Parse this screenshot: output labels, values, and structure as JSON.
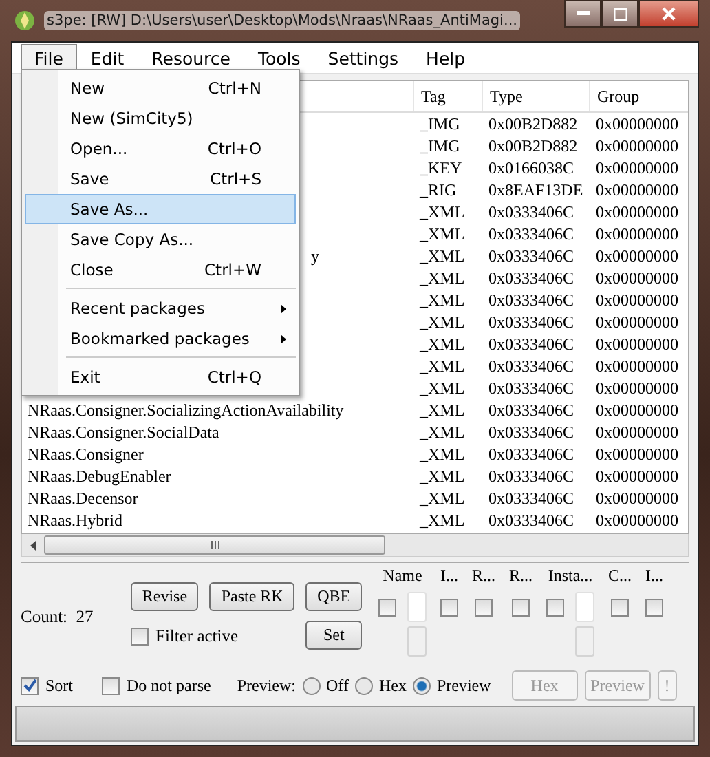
{
  "window": {
    "title": "s3pe: [RW] D:\\Users\\user\\Desktop\\Mods\\Nraas\\NRaas_AntiMagi..."
  },
  "menu_bar": [
    {
      "label": "File",
      "selected": true
    },
    {
      "label": "Edit",
      "selected": false
    },
    {
      "label": "Resource",
      "selected": false
    },
    {
      "label": "Tools",
      "selected": false
    },
    {
      "label": "Settings",
      "selected": false
    },
    {
      "label": "Help",
      "selected": false
    }
  ],
  "file_menu": [
    {
      "kind": "item",
      "label": "New",
      "shortcut": "Ctrl+N",
      "selected": false
    },
    {
      "kind": "item",
      "label": "New (SimCity5)",
      "selected": false
    },
    {
      "kind": "item",
      "label": "Open...",
      "shortcut": "Ctrl+O",
      "selected": false
    },
    {
      "kind": "item",
      "label": "Save",
      "shortcut": "Ctrl+S",
      "selected": false
    },
    {
      "kind": "item",
      "label": "Save As...",
      "selected": true
    },
    {
      "kind": "item",
      "label": "Save Copy As...",
      "selected": false
    },
    {
      "kind": "item",
      "label": "Close",
      "shortcut": "Ctrl+W",
      "selected": false
    },
    {
      "kind": "separator"
    },
    {
      "kind": "submenu",
      "label": "Recent packages",
      "selected": false
    },
    {
      "kind": "submenu",
      "label": "Bookmarked packages",
      "selected": false
    },
    {
      "kind": "separator"
    },
    {
      "kind": "item",
      "label": "Exit",
      "shortcut": "Ctrl+Q",
      "selected": false
    }
  ],
  "table": {
    "columns": [
      "Tag",
      "Type",
      "Group"
    ],
    "rows": [
      {
        "tag": "_IMG",
        "type": "0x00B2D882",
        "group": "0x00000000"
      },
      {
        "tag": "_IMG",
        "type": "0x00B2D882",
        "group": "0x00000000"
      },
      {
        "tag": "_KEY",
        "type": "0x0166038C",
        "group": "0x00000000"
      },
      {
        "tag": "_RIG",
        "type": "0x8EAF13DE",
        "group": "0x00000000"
      },
      {
        "tag": "_XML",
        "type": "0x0333406C",
        "group": "0x00000000"
      },
      {
        "tag": "_XML",
        "type": "0x0333406C",
        "group": "0x00000000"
      },
      {
        "name_tail": "y",
        "tag": "_XML",
        "type": "0x0333406C",
        "group": "0x00000000"
      },
      {
        "tag": "_XML",
        "type": "0x0333406C",
        "group": "0x00000000"
      },
      {
        "tag": "_XML",
        "type": "0x0333406C",
        "group": "0x00000000"
      },
      {
        "tag": "_XML",
        "type": "0x0333406C",
        "group": "0x00000000"
      },
      {
        "tag": "_XML",
        "type": "0x0333406C",
        "group": "0x00000000"
      },
      {
        "tag": "_XML",
        "type": "0x0333406C",
        "group": "0x00000000"
      },
      {
        "tag": "_XML",
        "type": "0x0333406C",
        "group": "0x00000000"
      },
      {
        "name": "NRaas.Consigner.SocializingActionAvailability",
        "tag": "_XML",
        "type": "0x0333406C",
        "group": "0x00000000"
      },
      {
        "name": "NRaas.Consigner.SocialData",
        "tag": "_XML",
        "type": "0x0333406C",
        "group": "0x00000000"
      },
      {
        "name": "NRaas.Consigner",
        "tag": "_XML",
        "type": "0x0333406C",
        "group": "0x00000000"
      },
      {
        "name": "NRaas.DebugEnabler",
        "tag": "_XML",
        "type": "0x0333406C",
        "group": "0x00000000"
      },
      {
        "name": "NRaas.Decensor",
        "tag": "_XML",
        "type": "0x0333406C",
        "group": "0x00000000"
      },
      {
        "name": "NRaas.Hybrid",
        "tag": "_XML",
        "type": "0x0333406C",
        "group": "0x00000000"
      }
    ]
  },
  "count": {
    "label": "Count:",
    "value": "27"
  },
  "buttons": {
    "revise": "Revise",
    "paste_rk": "Paste RK",
    "qbe": "QBE",
    "set": "Set"
  },
  "filter_active": {
    "label": "Filter active",
    "checked": false
  },
  "filter_columns": [
    {
      "label": "Name",
      "kind": "text",
      "checked": false
    },
    {
      "label": "I...",
      "kind": "check",
      "checked": false
    },
    {
      "label": "R...",
      "kind": "check",
      "checked": false
    },
    {
      "label": "R...",
      "kind": "check",
      "checked": false
    },
    {
      "label": "Insta...",
      "kind": "text",
      "checked": false
    },
    {
      "label": "C...",
      "kind": "check",
      "checked": false
    },
    {
      "label": "I...",
      "kind": "check",
      "checked": false
    }
  ],
  "sort": {
    "label": "Sort",
    "checked": true
  },
  "do_not_parse": {
    "label": "Do not parse",
    "checked": false
  },
  "preview": {
    "label": "Preview:",
    "options": [
      {
        "label": "Off",
        "selected": false
      },
      {
        "label": "Hex",
        "selected": false
      },
      {
        "label": "Preview",
        "selected": true
      }
    ]
  },
  "action_buttons": [
    {
      "label": "Hex",
      "disabled": true
    },
    {
      "label": "Preview",
      "disabled": true
    },
    {
      "label": "!",
      "disabled": true
    }
  ]
}
